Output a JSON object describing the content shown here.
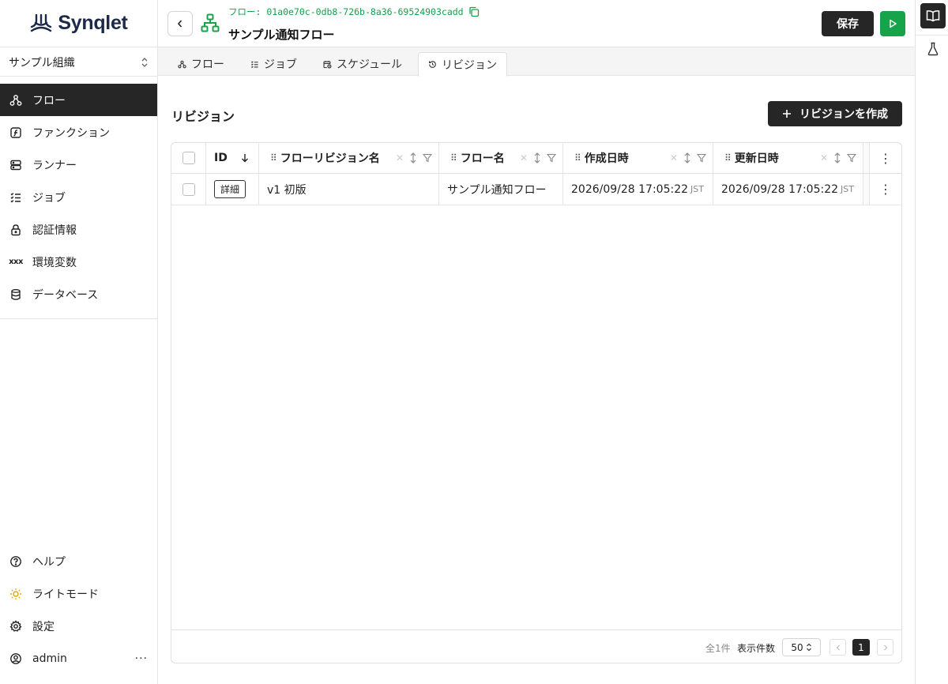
{
  "app": {
    "logo_text": "Synqlet",
    "brand_color": "#1b2a48",
    "accent_color": "#16a34a"
  },
  "sidebar": {
    "org": "サンプル組織",
    "items": [
      {
        "label": "フロー",
        "icon": "flow-icon",
        "active": true
      },
      {
        "label": "ファンクション",
        "icon": "function-icon"
      },
      {
        "label": "ランナー",
        "icon": "server-icon"
      },
      {
        "label": "ジョブ",
        "icon": "list-check-icon"
      },
      {
        "label": "認証情報",
        "icon": "lock-icon"
      },
      {
        "label": "環境変数",
        "icon": "variable-icon",
        "icon_text": "xxx"
      },
      {
        "label": "データベース",
        "icon": "database-icon"
      }
    ],
    "bottom": [
      {
        "label": "ヘルプ",
        "icon": "help-icon"
      },
      {
        "label": "ライトモード",
        "icon": "sun-icon"
      },
      {
        "label": "設定",
        "icon": "gear-icon"
      },
      {
        "label": "admin",
        "icon": "user-icon"
      }
    ],
    "more": "···"
  },
  "header": {
    "flow_id": "フロー: 01a0e70c-0db8-726b-8a36-69524903cadd",
    "title": "サンプル通知フロー",
    "save_label": "保存"
  },
  "tabs": [
    {
      "label": "フロー",
      "icon": "flow-icon"
    },
    {
      "label": "ジョブ",
      "icon": "list-check-icon"
    },
    {
      "label": "スケジュール",
      "icon": "calendar-clock-icon"
    },
    {
      "label": "リビジョン",
      "icon": "history-icon",
      "active": true
    }
  ],
  "main": {
    "section_title": "リビジョン",
    "create_label": "リビジョンを作成",
    "table": {
      "columns": [
        "ID",
        "フローリビジョン名",
        "フロー名",
        "作成日時",
        "更新日時"
      ],
      "rows": [
        {
          "detail": "詳細",
          "revision_name": "v1 初版",
          "flow_name": "サンプル通知フロー",
          "created": "2026/09/28 17:05:22",
          "created_tz": "JST",
          "updated": "2026/09/28 17:05:22",
          "updated_tz": "JST"
        }
      ],
      "footer": {
        "total": "全1件",
        "per_page_label": "表示件数",
        "per_page": "50",
        "page": "1"
      }
    }
  }
}
